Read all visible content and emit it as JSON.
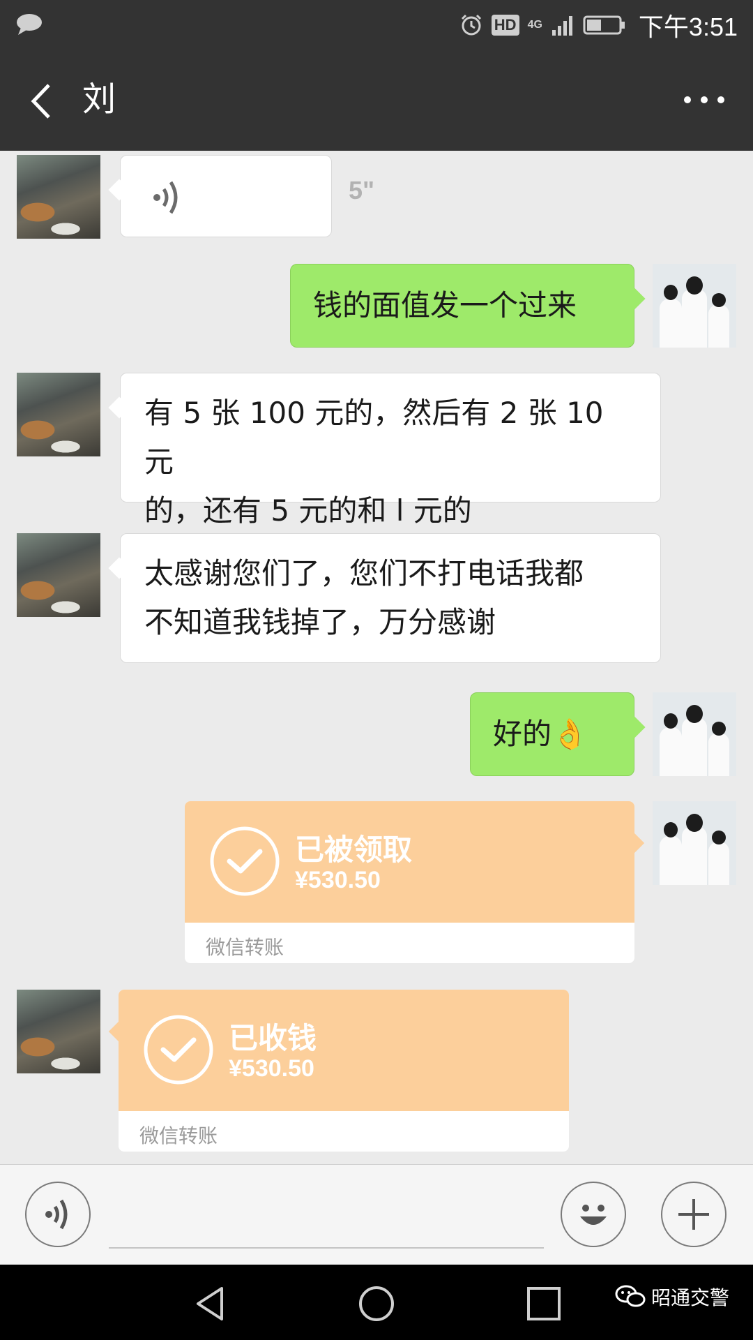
{
  "status_bar": {
    "time": "下午3:51",
    "hd_label": "HD",
    "network": "4G"
  },
  "header": {
    "title": "刘"
  },
  "messages": {
    "voice": {
      "duration": "5\""
    },
    "m1": {
      "text": "钱的面值发一个过来"
    },
    "m2": {
      "line1": "有 5 张 100 元的，然后有 2 张 10 元",
      "line2": "的，还有 5 元的和 l 元的"
    },
    "m3": {
      "line1": "太感谢您们了，您们不打电话我都",
      "line2": "不知道我钱掉了，万分感谢"
    },
    "m4": {
      "text": "好的",
      "emoji": "👌"
    },
    "transfer_sent": {
      "status": "已被领取",
      "amount": "¥530.50",
      "footer": "微信转账"
    },
    "transfer_received": {
      "status": "已收钱",
      "amount": "¥530.50",
      "footer": "微信转账"
    }
  },
  "watermark": {
    "text": "昭通交警"
  },
  "colors": {
    "header_bg": "#333333",
    "chat_bg": "#ebebeb",
    "my_bubble": "#9eea6a",
    "transfer": "#fccf9b"
  }
}
